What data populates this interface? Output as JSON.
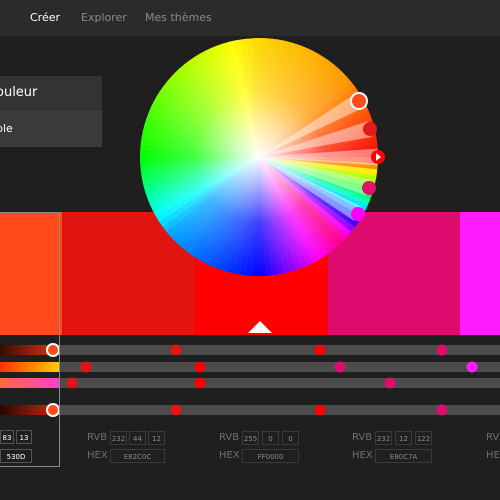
{
  "nav": {
    "tabs": [
      "Créer",
      "Explorer",
      "Mes thèmes"
    ],
    "active": "Créer"
  },
  "harmony_panel": {
    "label": "ouleur",
    "rule_label": "ble"
  },
  "wheel": {
    "markers": [
      {
        "color": "#ff4a1c",
        "base": false
      },
      {
        "color": "#e21a1a",
        "base": false
      },
      {
        "color": "#ff0000",
        "base": true
      },
      {
        "color": "#e0126a",
        "base": false
      },
      {
        "color": "#ff00ff",
        "base": false
      }
    ]
  },
  "swatches": [
    {
      "name": "swatch-1",
      "hex": "#ff4a1c"
    },
    {
      "name": "swatch-2",
      "hex": "#e2140f"
    },
    {
      "name": "swatch-3",
      "hex": "#ff0000"
    },
    {
      "name": "swatch-4",
      "hex": "#de0c6e"
    },
    {
      "name": "swatch-5",
      "hex": "#ff1dff"
    }
  ],
  "sliders": {
    "fills": [
      "#e03a10",
      "#ffd000",
      "#ff3fd0",
      "#d42a10"
    ],
    "handle_colors": [
      "#ff4a1c",
      "#e2140f",
      "#ff0000",
      "#de0c6e",
      "#ff1dff"
    ]
  },
  "fields": {
    "rgb_label": "RVB",
    "hex_label": "HEX",
    "selected": {
      "rgb": [
        "83",
        "13"
      ],
      "hex": "530D"
    },
    "swatch2": {
      "rgb": [
        "232",
        "44",
        "12"
      ],
      "hex": "E82C0C"
    },
    "swatch3": {
      "rgb": [
        "255",
        "0",
        "0"
      ],
      "hex": "FF0000"
    },
    "swatch4": {
      "rgb": [
        "232",
        "12",
        "122"
      ],
      "hex": "E80C7A"
    }
  }
}
